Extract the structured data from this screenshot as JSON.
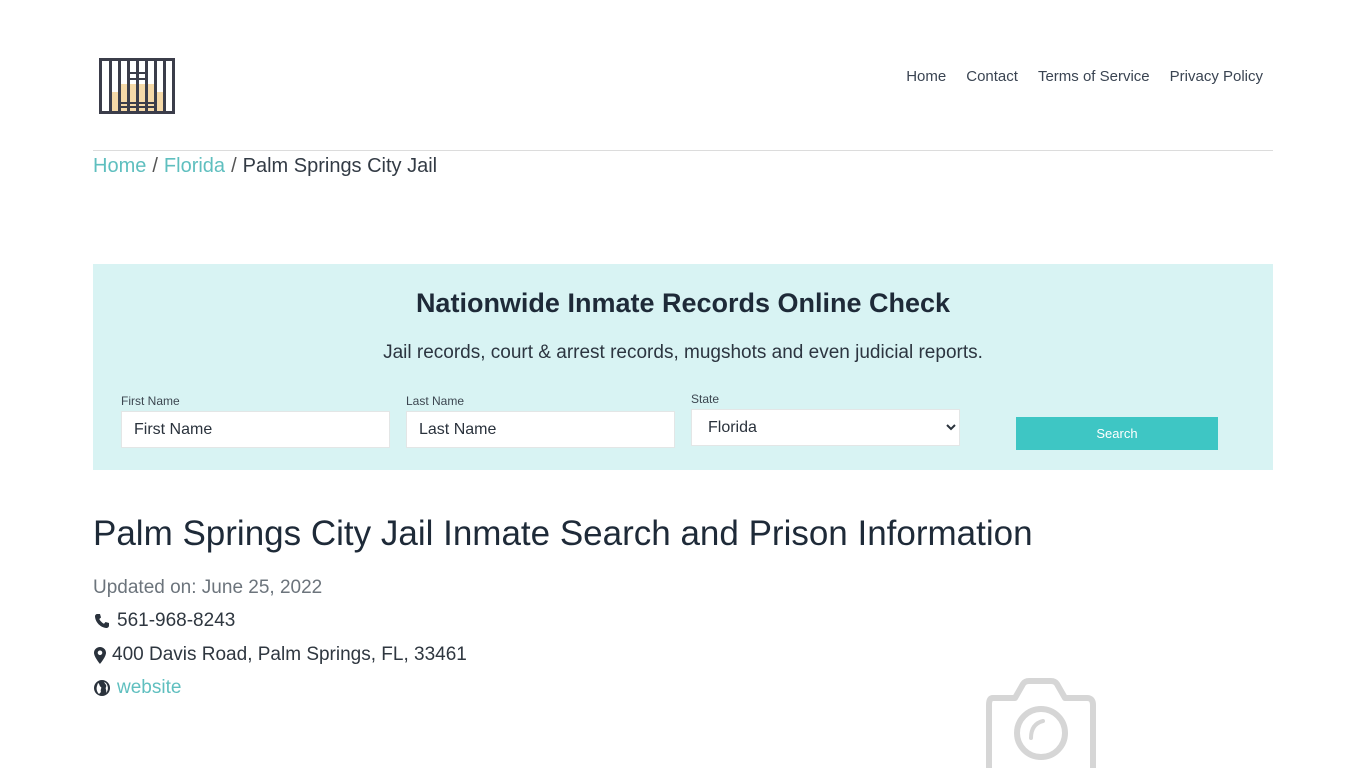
{
  "header": {
    "logo_icon": "jail-bars-icon",
    "nav": [
      {
        "label": "Home"
      },
      {
        "label": "Contact"
      },
      {
        "label": "Terms of Service"
      },
      {
        "label": "Privacy Policy"
      }
    ]
  },
  "breadcrumb": {
    "items": [
      {
        "label": "Home",
        "link": true
      },
      {
        "label": "Florida",
        "link": true
      },
      {
        "label": "Palm Springs City Jail",
        "link": false
      }
    ],
    "separator": "/"
  },
  "search_panel": {
    "title": "Nationwide Inmate Records Online Check",
    "subtitle": "Jail records, court & arrest records, mugshots and even judicial reports.",
    "first_name": {
      "label": "First Name",
      "placeholder": "First Name",
      "value": ""
    },
    "last_name": {
      "label": "Last Name",
      "placeholder": "Last Name",
      "value": ""
    },
    "state": {
      "label": "State",
      "selected": "Florida"
    },
    "button_label": "Search",
    "background": "#d8f3f3",
    "accent": "#3ec6c4"
  },
  "main": {
    "title": "Palm Springs City Jail Inmate Search and Prison Information",
    "updated": "Updated on: June 25, 2022",
    "phone": "561-968-8243",
    "address": "400 Davis Road, Palm Springs, FL, 33461",
    "website_label": "website",
    "image_placeholder_icon": "camera-icon"
  }
}
